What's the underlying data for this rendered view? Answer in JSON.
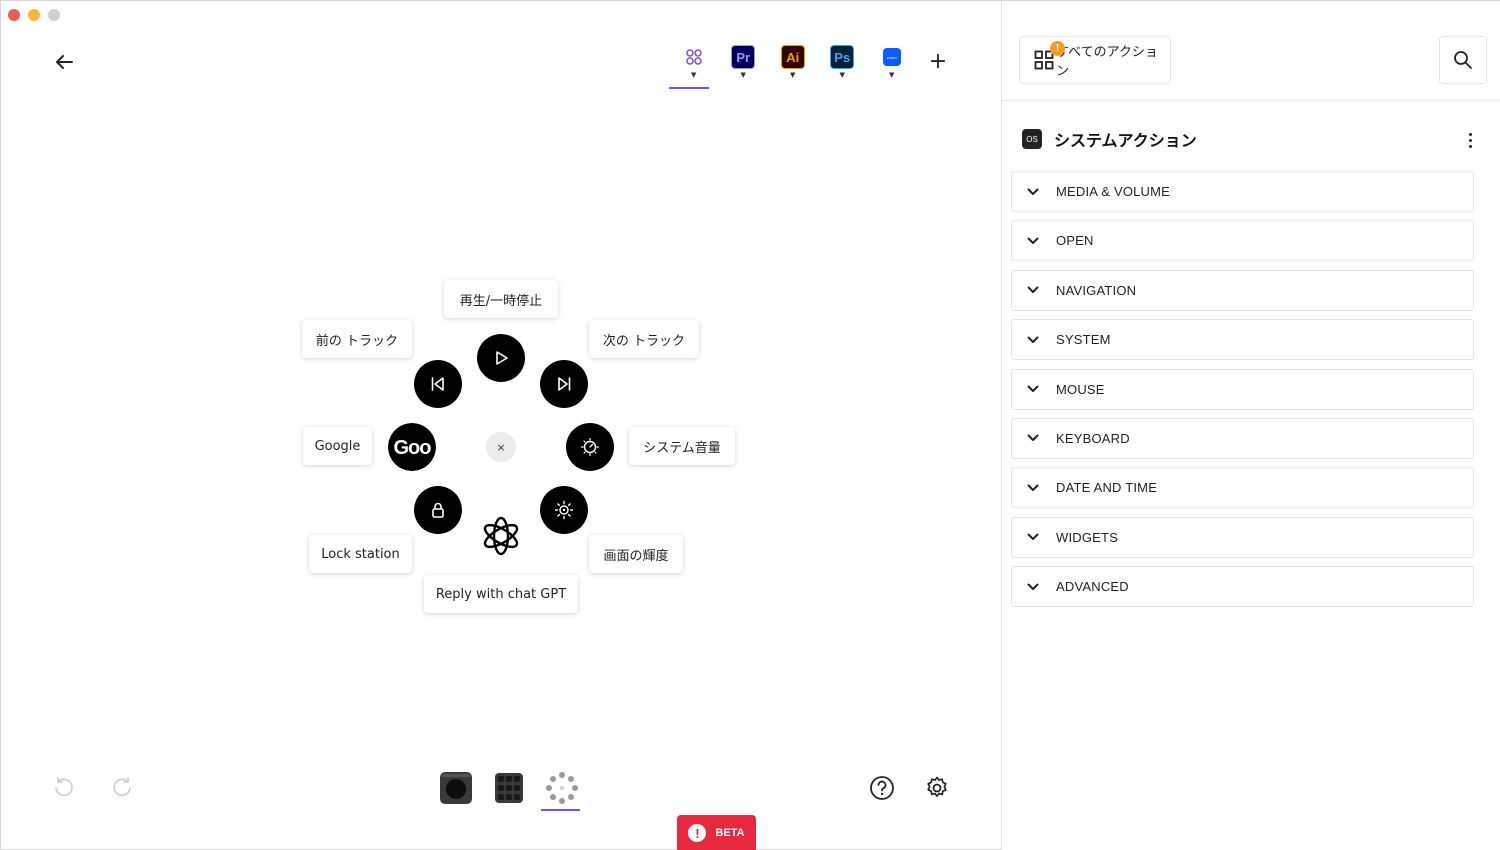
{
  "window": {
    "controls": [
      "close",
      "minimize",
      "zoom"
    ]
  },
  "toolbar": {
    "app_tabs": [
      {
        "name": "all-apps",
        "icon": "grid-dots-icon",
        "active": true
      },
      {
        "name": "premiere-pro",
        "short": "Pr"
      },
      {
        "name": "illustrator",
        "short": "Ai"
      },
      {
        "name": "photoshop",
        "short": "Ps"
      },
      {
        "name": "zoom",
        "short": "zoom"
      }
    ],
    "add_label": "+"
  },
  "wheel": {
    "center_close": "×",
    "actions": [
      {
        "id": "play-pause",
        "label": "再生/一時停止",
        "icon": "play-icon"
      },
      {
        "id": "next-track",
        "label": "次の トラック",
        "icon": "skip-next-icon"
      },
      {
        "id": "system-volume",
        "label": "システム音量",
        "icon": "volume-dial-icon"
      },
      {
        "id": "screen-brightness",
        "label": "画面の輝度",
        "icon": "brightness-icon"
      },
      {
        "id": "reply-chat-gpt",
        "label": "Reply with chat GPT",
        "icon": "openai-logo"
      },
      {
        "id": "lock-station",
        "label": "Lock station",
        "icon": "lock-icon"
      },
      {
        "id": "google",
        "label": "Google",
        "icon": "google-logo"
      },
      {
        "id": "previous-track",
        "label": "前の トラック",
        "icon": "skip-previous-icon"
      }
    ]
  },
  "footer": {
    "layout_tabs": [
      {
        "name": "dial-layout",
        "icon": "dial-icon"
      },
      {
        "name": "keypad-layout",
        "icon": "keypad-icon"
      },
      {
        "name": "actions-ring-layout",
        "icon": "ring-dots-icon",
        "active": true
      }
    ],
    "beta_label": "BETA",
    "beta_icon": "!"
  },
  "panel": {
    "all_actions_label": "すべてのアクション",
    "badge": "!",
    "section_badge": "OS",
    "section_title": "システムアクション",
    "categories": [
      "MEDIA & VOLUME",
      "OPEN",
      "NAVIGATION",
      "SYSTEM",
      "MOUSE",
      "KEYBOARD",
      "DATE AND TIME",
      "WIDGETS",
      "ADVANCED"
    ]
  },
  "colors": {
    "accent": "#7b4fe0",
    "beta": "#e8283f",
    "badge": "#f59a23"
  }
}
